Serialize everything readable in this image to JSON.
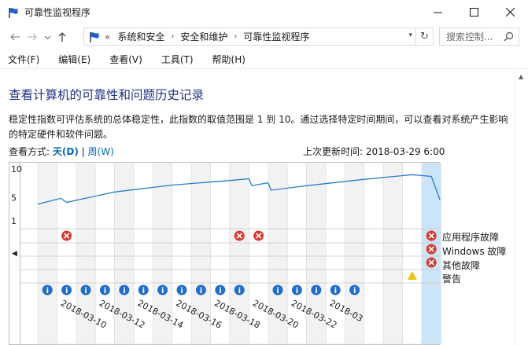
{
  "window": {
    "title": "可靠性监视程序",
    "minimize_icon": "minimize-icon",
    "maximize_icon": "maximize-icon",
    "close_icon": "close-icon"
  },
  "address": {
    "prefix": "«",
    "crumbs": [
      "系统和安全",
      "安全和维护",
      "可靠性监视程序"
    ],
    "search_placeholder": "搜索控制..."
  },
  "menu": [
    "文件(F)",
    "编辑(E)",
    "查看(V)",
    "工具(T)",
    "帮助(H)"
  ],
  "page": {
    "heading": "查看计算机的可靠性和问题历史记录",
    "description": "稳定性指数可评估系统的总体稳定性，此指数的取值范围是 1 到 10。通过选择特定时间期间，可以查看对系统产生影响的特定硬件和软件问题。",
    "view_by_label": "查看方式:",
    "view_day": "天(D)",
    "view_sep": "|",
    "view_week": "周(W)",
    "last_update": "上次更新时间: 2018-03-29 6:00"
  },
  "chart_data": {
    "type": "line",
    "y_ticks": [
      "10",
      "5",
      "1"
    ],
    "ylim": [
      1,
      10
    ],
    "x_tick_labels": [
      "2018-03-10",
      "2018-03-12",
      "2018-03-14",
      "2018-03-16",
      "2018-03-18",
      "2018-03-20",
      "2018-03-22",
      "2018-03"
    ],
    "day_count": 21,
    "selected_day_index": 20,
    "stability_index": [
      [
        0,
        3.9
      ],
      [
        1.2,
        4.9
      ],
      [
        1.5,
        4.2
      ],
      [
        4,
        6.0
      ],
      [
        7,
        7.2
      ],
      [
        10,
        8.0
      ],
      [
        11.0,
        8.3
      ],
      [
        11.15,
        7.1
      ],
      [
        12.0,
        7.6
      ],
      [
        12.15,
        6.3
      ],
      [
        14,
        7.1
      ],
      [
        17,
        8.2
      ],
      [
        19.5,
        9.0
      ],
      [
        20.5,
        8.7
      ],
      [
        20.95,
        4.6
      ]
    ],
    "rows": [
      {
        "label": "应用程序故障",
        "icon": "error",
        "days": [
          1,
          10,
          11,
          20
        ]
      },
      {
        "label": "Windows 故障",
        "icon": "error",
        "days": [
          20
        ]
      },
      {
        "label": "其他故障",
        "icon": "error",
        "days": [
          20
        ]
      },
      {
        "label": "警告",
        "icon": "warning",
        "days": [
          19
        ]
      },
      {
        "label": "信息",
        "icon": "info",
        "days": [
          0,
          1,
          2,
          3,
          4,
          5,
          6,
          7,
          8,
          9,
          10,
          12,
          13,
          14,
          15,
          16
        ]
      }
    ],
    "grid": true
  }
}
